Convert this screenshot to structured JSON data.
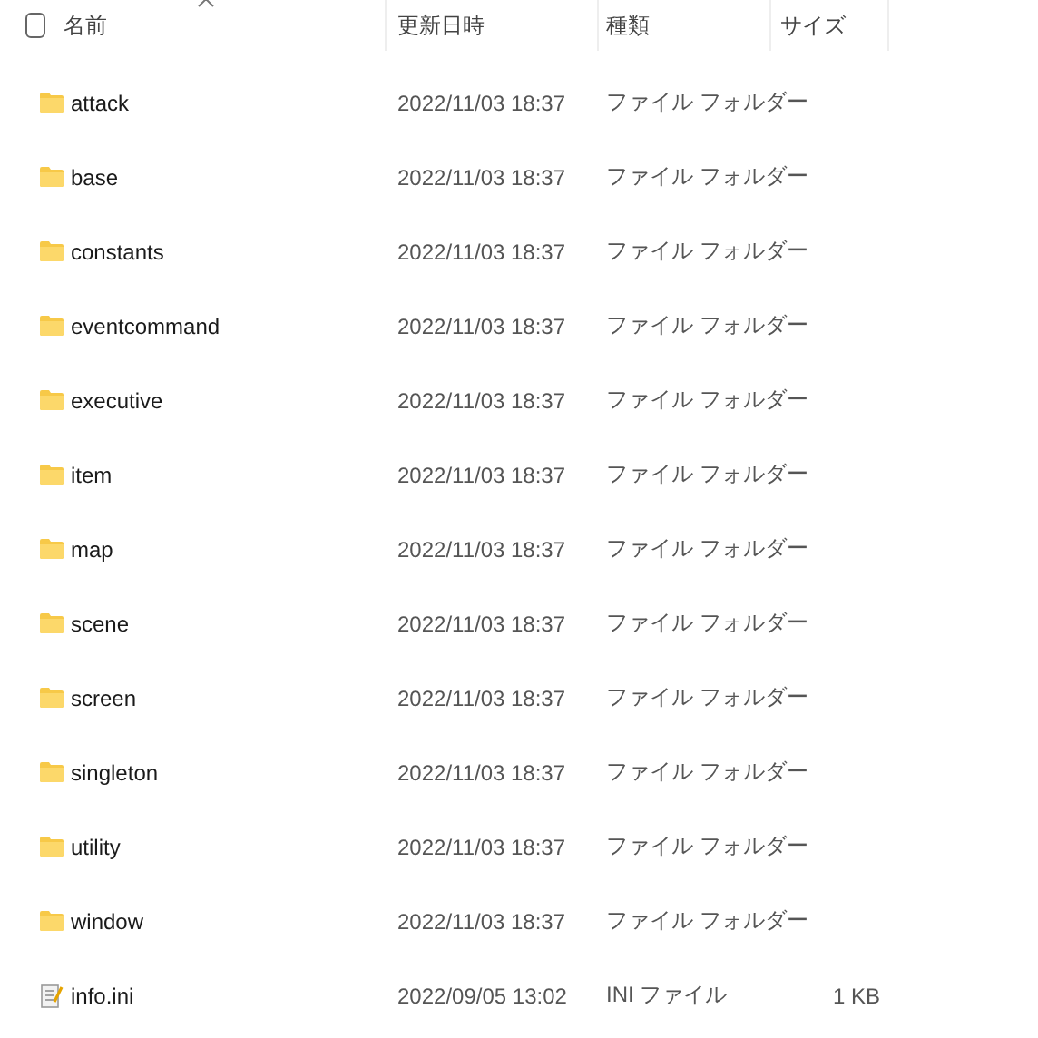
{
  "columns": [
    {
      "label": "名前"
    },
    {
      "label": "更新日時"
    },
    {
      "label": "種類"
    },
    {
      "label": "サイズ"
    }
  ],
  "select_all": {
    "checked": false
  },
  "rows": [
    {
      "kind": "folder",
      "name": "attack",
      "modified": "2022/11/03 18:37",
      "type": "ファイル フォルダー"
    },
    {
      "kind": "folder",
      "name": "base",
      "modified": "2022/11/03 18:37",
      "type": "ファイル フォルダー"
    },
    {
      "kind": "folder",
      "name": "constants",
      "modified": "2022/11/03 18:37",
      "type": "ファイル フォルダー"
    },
    {
      "kind": "folder",
      "name": "eventcommand",
      "modified": "2022/11/03 18:37",
      "type": "ファイル フォルダー"
    },
    {
      "kind": "folder",
      "name": "executive",
      "modified": "2022/11/03 18:37",
      "type": "ファイル フォルダー"
    },
    {
      "kind": "folder",
      "name": "item",
      "modified": "2022/11/03 18:37",
      "type": "ファイル フォルダー"
    },
    {
      "kind": "folder",
      "name": "map",
      "modified": "2022/11/03 18:37",
      "type": "ファイル フォルダー"
    },
    {
      "kind": "folder",
      "name": "scene",
      "modified": "2022/11/03 18:37",
      "type": "ファイル フォルダー"
    },
    {
      "kind": "folder",
      "name": "screen",
      "modified": "2022/11/03 18:37",
      "type": "ファイル フォルダー"
    },
    {
      "kind": "folder",
      "name": "singleton",
      "modified": "2022/11/03 18:37",
      "type": "ファイル フォルダー"
    },
    {
      "kind": "folder",
      "name": "utility",
      "modified": "2022/11/03 18:37",
      "type": "ファイル フォルダー"
    },
    {
      "kind": "folder",
      "name": "window",
      "modified": "2022/11/03 18:37",
      "type": "ファイル フォルダー"
    },
    {
      "kind": "file",
      "name": "info.ini",
      "modified": "2022/09/05 13:02",
      "type": "INI ファイル",
      "size": "1 KB"
    }
  ]
}
